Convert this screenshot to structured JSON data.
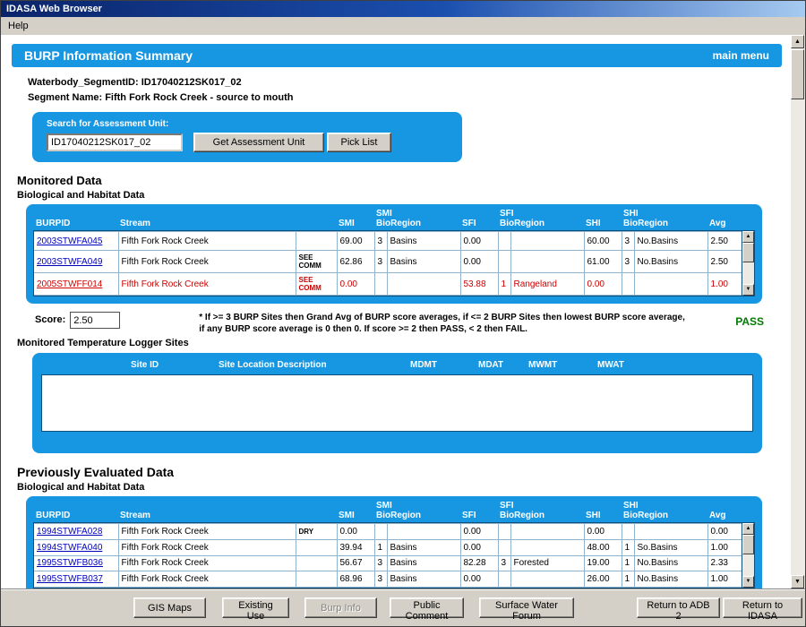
{
  "colors": {
    "panel_blue": "#1797e2",
    "link_blue": "#0000bb",
    "alert_red": "#cc0000",
    "pass_green": "#007a00",
    "chrome_gray": "#d4d0c8"
  },
  "icons": {
    "scroll_up": "▲",
    "scroll_down": "▼"
  },
  "window": {
    "title": "IDASA Web Browser",
    "menu": {
      "help": "Help"
    }
  },
  "page": {
    "title": "BURP Information Summary",
    "main_menu": "main menu",
    "waterbody_label": "Waterbody_SegmentID:",
    "waterbody_id": "ID17040212SK017_02",
    "segment_label": "Segment Name:",
    "segment_name": "Fifth Fork Rock Creek - source to mouth"
  },
  "search": {
    "label": "Search for Assessment Unit:",
    "value": "ID17040212SK017_02",
    "get_button": "Get Assessment Unit",
    "pick_list_button": "Pick List"
  },
  "table_headers": {
    "burpid": "BURPID",
    "stream": "Stream",
    "smi": "SMI",
    "sfi": "SFI",
    "shi": "SHI",
    "bioregion": "BioRegion",
    "avg": "Avg"
  },
  "monitored": {
    "title": "Monitored Data",
    "subtitle": "Biological and Habitat Data",
    "rows": [
      {
        "burpid": "2003STWFA045",
        "stream": "Fifth Fork Rock Creek",
        "comm": "",
        "smi": "69.00",
        "smi_n": "3",
        "smi_bio": "Basins",
        "sfi": "0.00",
        "sfi_n": "",
        "sfi_bio": "",
        "shi": "60.00",
        "shi_n": "3",
        "shi_bio": "No.Basins",
        "avg": "2.50",
        "cls": ""
      },
      {
        "burpid": "2003STWFA049",
        "stream": "Fifth Fork Rock Creek",
        "comm": "SEE\nCOMM",
        "smi": "62.86",
        "smi_n": "3",
        "smi_bio": "Basins",
        "sfi": "0.00",
        "sfi_n": "",
        "sfi_bio": "",
        "shi": "61.00",
        "shi_n": "3",
        "shi_bio": "No.Basins",
        "avg": "2.50",
        "cls": ""
      },
      {
        "burpid": "2005STWFF014",
        "stream": "Fifth Fork Rock Creek",
        "comm": "SEE\nCOMM",
        "smi": "0.00",
        "smi_n": "",
        "smi_bio": "",
        "sfi": "53.88",
        "sfi_n": "1",
        "sfi_bio": "Rangeland",
        "shi": "0.00",
        "shi_n": "",
        "shi_bio": "",
        "avg": "1.00",
        "cls": "red"
      }
    ]
  },
  "score": {
    "label": "Score:",
    "value": "2.50",
    "note": "* If >= 3 BURP Sites then Grand Avg of BURP score averages, if <= 2 BURP Sites then lowest BURP score average, if any BURP score average is 0 then 0. If score >= 2 then PASS, < 2 then FAIL.",
    "result": "PASS"
  },
  "temperature": {
    "title": "Monitored Temperature Logger Sites",
    "headers": {
      "site_id": "Site ID",
      "description": "Site Location Description",
      "mdmt": "MDMT",
      "mdat": "MDAT",
      "mwmt": "MWMT",
      "mwat": "MWAT"
    }
  },
  "previous": {
    "title": "Previously Evaluated Data",
    "subtitle": "Biological and Habitat Data",
    "rows": [
      {
        "burpid": "1994STWFA028",
        "stream": "Fifth Fork Rock Creek",
        "comm": "DRY",
        "smi": "0.00",
        "smi_n": "",
        "smi_bio": "",
        "sfi": "0.00",
        "sfi_n": "",
        "sfi_bio": "",
        "shi": "0.00",
        "shi_n": "",
        "shi_bio": "",
        "avg": "0.00",
        "cls": ""
      },
      {
        "burpid": "1994STWFA040",
        "stream": "Fifth Fork Rock Creek",
        "comm": "",
        "smi": "39.94",
        "smi_n": "1",
        "smi_bio": "Basins",
        "sfi": "0.00",
        "sfi_n": "",
        "sfi_bio": "",
        "shi": "48.00",
        "shi_n": "1",
        "shi_bio": "So.Basins",
        "avg": "1.00",
        "cls": ""
      },
      {
        "burpid": "1995STWFB036",
        "stream": "Fifth Fork Rock Creek",
        "comm": "",
        "smi": "56.67",
        "smi_n": "3",
        "smi_bio": "Basins",
        "sfi": "82.28",
        "sfi_n": "3",
        "sfi_bio": "Forested",
        "shi": "19.00",
        "shi_n": "1",
        "shi_bio": "No.Basins",
        "avg": "2.33",
        "cls": ""
      },
      {
        "burpid": "1995STWFB037",
        "stream": "Fifth Fork Rock Creek",
        "comm": "",
        "smi": "68.96",
        "smi_n": "3",
        "smi_bio": "Basins",
        "sfi": "0.00",
        "sfi_n": "",
        "sfi_bio": "",
        "shi": "26.00",
        "shi_n": "1",
        "shi_bio": "No.Basins",
        "avg": "1.00",
        "cls": ""
      }
    ]
  },
  "footer": {
    "gis_maps": "GIS Maps",
    "existing_use": "Existing Use",
    "burp_info": "Burp Info",
    "public_comment": "Public Comment",
    "surface_water_forum": "Surface Water Forum",
    "return_adb2": "Return to ADB 2",
    "return_idasa": "Return to IDASA"
  }
}
